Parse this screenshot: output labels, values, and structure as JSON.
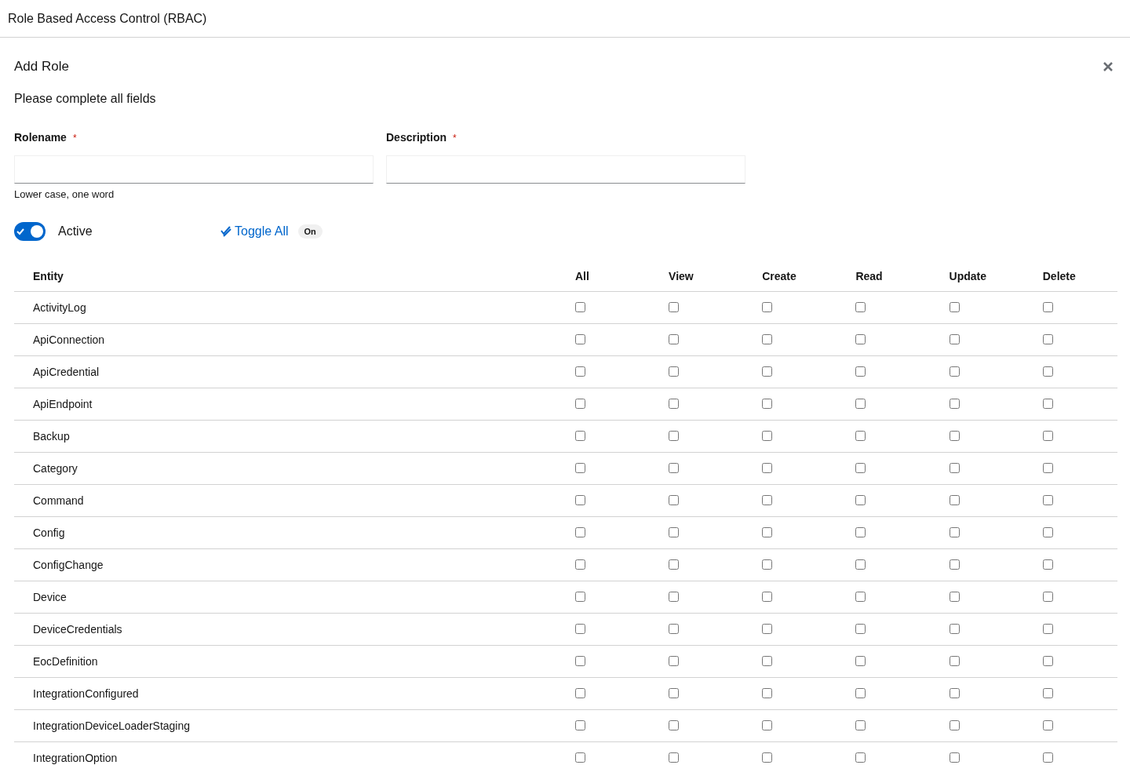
{
  "page_title": "Role Based Access Control (RBAC)",
  "modal": {
    "title": "Add Role",
    "subtitle": "Please complete all fields"
  },
  "fields": [
    {
      "label": "Rolename",
      "required_mark": "*",
      "helper": "Lower case, one word"
    },
    {
      "label": "Description",
      "required_mark": "*"
    }
  ],
  "active_switch": {
    "label": "Active",
    "on": true
  },
  "toggle_all": {
    "label": "Toggle All",
    "badge": "On"
  },
  "table": {
    "columns": [
      "Entity",
      "All",
      "View",
      "Create",
      "Read",
      "Update",
      "Delete"
    ],
    "rows": [
      {
        "entity": "ActivityLog",
        "checks": [
          {
            "checked": false
          },
          {
            "checked": false
          },
          {
            "checked": false
          },
          {
            "checked": false
          },
          {
            "checked": false
          },
          {
            "checked": false
          }
        ]
      },
      {
        "entity": "ApiConnection",
        "checks": [
          {
            "checked": false
          },
          {
            "checked": false
          },
          {
            "checked": false
          },
          {
            "checked": false
          },
          {
            "checked": false
          },
          {
            "checked": false
          }
        ]
      },
      {
        "entity": "ApiCredential",
        "checks": [
          {
            "checked": false
          },
          {
            "checked": false
          },
          {
            "checked": false
          },
          {
            "checked": false
          },
          {
            "checked": false
          },
          {
            "checked": false
          }
        ]
      },
      {
        "entity": "ApiEndpoint",
        "checks": [
          {
            "checked": false
          },
          {
            "checked": false
          },
          {
            "checked": false
          },
          {
            "checked": false
          },
          {
            "checked": false
          },
          {
            "checked": false
          }
        ]
      },
      {
        "entity": "Backup",
        "checks": [
          {
            "checked": false
          },
          {
            "checked": false
          },
          {
            "checked": false
          },
          {
            "checked": false
          },
          {
            "checked": false
          },
          {
            "checked": false
          }
        ]
      },
      {
        "entity": "Category",
        "checks": [
          {
            "checked": false
          },
          {
            "checked": false
          },
          {
            "checked": false
          },
          {
            "checked": false
          },
          {
            "checked": false
          },
          {
            "checked": false
          }
        ]
      },
      {
        "entity": "Command",
        "checks": [
          {
            "checked": false
          },
          {
            "checked": false
          },
          {
            "checked": false
          },
          {
            "checked": false
          },
          {
            "checked": false
          },
          {
            "checked": false
          }
        ]
      },
      {
        "entity": "Config",
        "checks": [
          {
            "checked": false
          },
          {
            "checked": false
          },
          {
            "checked": false
          },
          {
            "checked": false
          },
          {
            "checked": false
          },
          {
            "checked": false
          }
        ]
      },
      {
        "entity": "ConfigChange",
        "checks": [
          {
            "checked": false
          },
          {
            "checked": false
          },
          {
            "checked": false
          },
          {
            "checked": false
          },
          {
            "checked": false
          },
          {
            "checked": false
          }
        ]
      },
      {
        "entity": "Device",
        "checks": [
          {
            "checked": false
          },
          {
            "checked": false
          },
          {
            "checked": false
          },
          {
            "checked": false
          },
          {
            "checked": false
          },
          {
            "checked": false
          }
        ]
      },
      {
        "entity": "DeviceCredentials",
        "checks": [
          {
            "checked": false
          },
          {
            "checked": false
          },
          {
            "checked": false
          },
          {
            "checked": false
          },
          {
            "checked": false
          },
          {
            "checked": false
          }
        ]
      },
      {
        "entity": "EocDefinition",
        "checks": [
          {
            "checked": false
          },
          {
            "checked": false
          },
          {
            "checked": false
          },
          {
            "checked": false
          },
          {
            "checked": false
          },
          {
            "checked": false
          }
        ]
      },
      {
        "entity": "IntegrationConfigured",
        "checks": [
          {
            "checked": false
          },
          {
            "checked": false
          },
          {
            "checked": false
          },
          {
            "checked": false
          },
          {
            "checked": false
          },
          {
            "checked": false
          }
        ]
      },
      {
        "entity": "IntegrationDeviceLoaderStaging",
        "checks": [
          {
            "checked": false
          },
          {
            "checked": false
          },
          {
            "checked": false
          },
          {
            "checked": false
          },
          {
            "checked": false
          },
          {
            "checked": false
          }
        ]
      },
      {
        "entity": "IntegrationOption",
        "checks": [
          {
            "checked": false
          },
          {
            "checked": false
          },
          {
            "checked": false
          },
          {
            "checked": false
          },
          {
            "checked": false
          },
          {
            "checked": false
          }
        ]
      }
    ]
  }
}
